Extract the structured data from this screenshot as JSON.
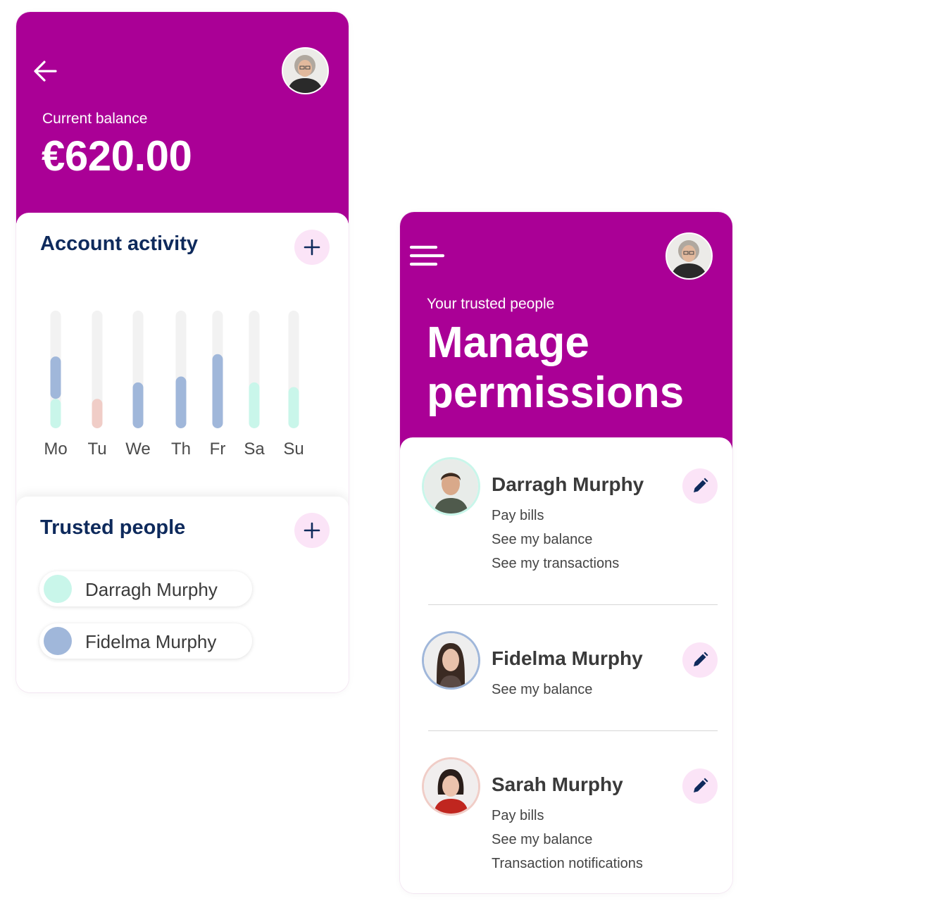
{
  "balance_screen": {
    "balance_label": "Current balance",
    "balance_value": "€620.00",
    "account_activity": {
      "title": "Account activity",
      "chart_data": {
        "type": "bar",
        "categories": [
          "Mo",
          "Tu",
          "We",
          "Th",
          "Fr",
          "Sa",
          "Su"
        ],
        "max": 1.0,
        "stacks": [
          [
            {
              "value": 0.25,
              "color": "#c9f6ea"
            },
            {
              "value": 0.36,
              "color": "#a0b7da"
            }
          ],
          [
            {
              "value": 0.25,
              "color": "#f0cdc7"
            }
          ],
          [
            {
              "value": 0.39,
              "color": "#a0b7da"
            }
          ],
          [
            {
              "value": 0.44,
              "color": "#a0b7da"
            }
          ],
          [
            {
              "value": 0.63,
              "color": "#a0b7da"
            }
          ],
          [
            {
              "value": 0.39,
              "color": "#c9f6ea"
            }
          ],
          [
            {
              "value": 0.35,
              "color": "#c9f6ea"
            }
          ]
        ]
      }
    },
    "trusted_people": {
      "title": "Trusted people",
      "people": [
        {
          "name": "Darragh Murphy",
          "color": "#c9f6ea"
        },
        {
          "name": "Fidelma Murphy",
          "color": "#a0b7da"
        }
      ]
    }
  },
  "permissions_screen": {
    "subtitle": "Your trusted people",
    "title": "Manage permissions",
    "people": [
      {
        "name": "Darragh Murphy",
        "ring_color": "#c9f6ea",
        "permissions": [
          "Pay bills",
          "See my balance",
          "See my transactions"
        ]
      },
      {
        "name": "Fidelma Murphy",
        "ring_color": "#a0b7da",
        "permissions": [
          "See my balance"
        ]
      },
      {
        "name": "Sarah Murphy",
        "ring_color": "#f0cdc7",
        "permissions": [
          "Pay bills",
          "See my balance",
          "Transaction notifications"
        ]
      }
    ]
  },
  "colors": {
    "brand": "#aa0096",
    "heading": "#0e2a5c",
    "button_bg": "#fbe4f7",
    "icon": "#0e2a5c"
  }
}
